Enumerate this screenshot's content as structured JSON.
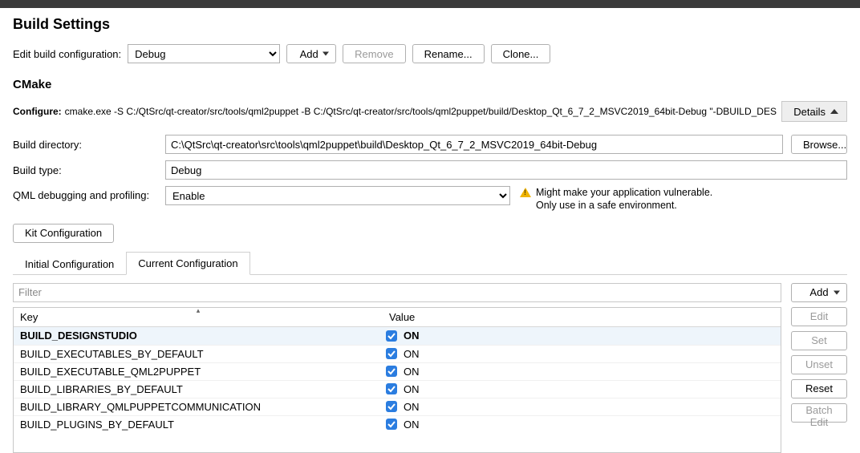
{
  "title": "Build Settings",
  "edit_conf": {
    "label": "Edit build configuration:",
    "value": "Debug",
    "add": "Add",
    "remove": "Remove",
    "rename": "Rename...",
    "clone": "Clone..."
  },
  "cmake": {
    "heading": "CMake",
    "configure_label": "Configure:",
    "configure_cmd": "cmake.exe -S C:/QtSrc/qt-creator/src/tools/qml2puppet -B C:/QtSrc/qt-creator/src/tools/qml2puppet/build/Desktop_Qt_6_7_2_MSVC2019_64bit-Debug \"-DBUILD_DESIGNS",
    "details": "Details",
    "build_dir_label": "Build directory:",
    "build_dir": "C:\\QtSrc\\qt-creator\\src\\tools\\qml2puppet\\build\\Desktop_Qt_6_7_2_MSVC2019_64bit-Debug",
    "browse": "Browse...",
    "build_type_label": "Build type:",
    "build_type": "Debug",
    "qml_label": "QML debugging and profiling:",
    "qml_value": "Enable",
    "warn_line1": "Might make your application vulnerable.",
    "warn_line2": "Only use in a safe environment.",
    "kit_conf": "Kit Configuration"
  },
  "tabs": {
    "initial": "Initial Configuration",
    "current": "Current Configuration"
  },
  "table": {
    "filter_placeholder": "Filter",
    "key_header": "Key",
    "value_header": "Value",
    "rows": [
      {
        "key": "BUILD_DESIGNSTUDIO",
        "value": "ON",
        "checked": true,
        "highlight": true
      },
      {
        "key": "BUILD_EXECUTABLES_BY_DEFAULT",
        "value": "ON",
        "checked": true,
        "highlight": false
      },
      {
        "key": "BUILD_EXECUTABLE_QML2PUPPET",
        "value": "ON",
        "checked": true,
        "highlight": false
      },
      {
        "key": "BUILD_LIBRARIES_BY_DEFAULT",
        "value": "ON",
        "checked": true,
        "highlight": false
      },
      {
        "key": "BUILD_LIBRARY_QMLPUPPETCOMMUNICATION",
        "value": "ON",
        "checked": true,
        "highlight": false
      },
      {
        "key": "BUILD_PLUGINS_BY_DEFAULT",
        "value": "ON",
        "checked": true,
        "highlight": false
      }
    ]
  },
  "side": {
    "add": "Add",
    "edit": "Edit",
    "set": "Set",
    "unset": "Unset",
    "reset": "Reset",
    "batch": "Batch Edit"
  }
}
